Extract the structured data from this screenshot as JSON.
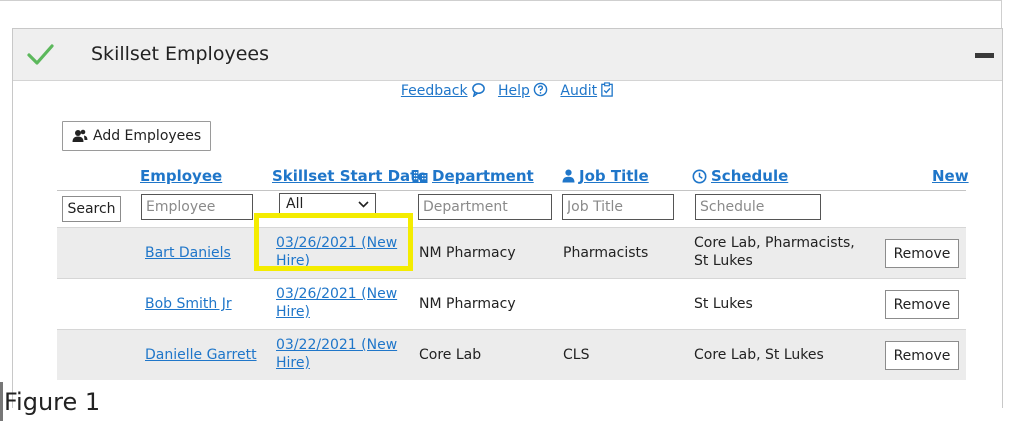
{
  "panel": {
    "title": "Skillset Employees",
    "accent_color": "#4caf50"
  },
  "links": {
    "feedback": "Feedback",
    "help": "Help",
    "audit": "Audit"
  },
  "toolbar": {
    "add_employees_label": "Add Employees"
  },
  "table": {
    "columns": {
      "employee": "Employee",
      "start_date": "Skillset Start Date",
      "department": "Department",
      "job_title": "Job Title",
      "schedule": "Schedule",
      "new": "New"
    },
    "filters": {
      "search_label": "Search",
      "employee_placeholder": "Employee",
      "start_date_selected": "All",
      "department_placeholder": "Department",
      "job_title_placeholder": "Job Title",
      "schedule_placeholder": "Schedule"
    },
    "rows": [
      {
        "employee": "Bart Daniels",
        "start_line1": "03/26/2021 (New",
        "start_line2": "Hire)",
        "department": "NM Pharmacy",
        "job_title": "Pharmacists",
        "schedule_line1": "Core Lab, Pharmacists,",
        "schedule_line2": "St Lukes",
        "action": "Remove"
      },
      {
        "employee": "Bob Smith Jr",
        "start_line1": "03/26/2021 (New",
        "start_line2": "Hire)",
        "department": "NM Pharmacy",
        "job_title": "",
        "schedule_line1": "St Lukes",
        "schedule_line2": "",
        "action": "Remove"
      },
      {
        "employee": "Danielle Garrett",
        "start_line1": "03/22/2021 (New",
        "start_line2": "Hire)",
        "department": "Core Lab",
        "job_title": "CLS",
        "schedule_line1": "Core Lab, St Lukes",
        "schedule_line2": "",
        "action": "Remove"
      }
    ]
  },
  "caption": "Figure 1",
  "colors": {
    "link": "#1f76c9",
    "highlight": "#f4ec00",
    "row_shade": "#ececec"
  }
}
